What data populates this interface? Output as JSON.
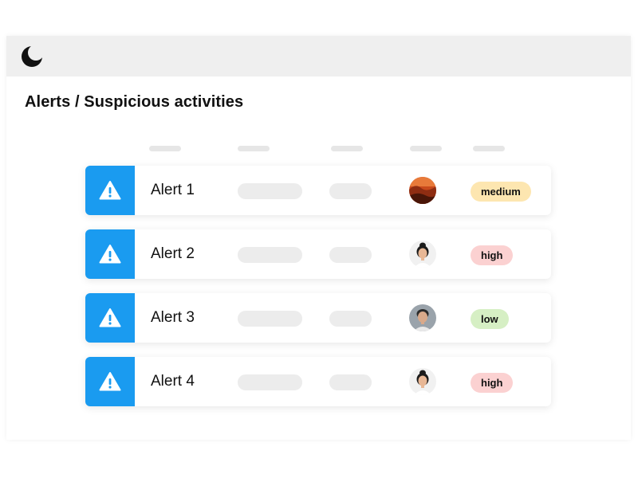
{
  "app": {
    "logo_icon": "moon-logo-icon"
  },
  "page": {
    "title": "Alerts / Suspicious activities"
  },
  "colors": {
    "accent": "#1a9bf0",
    "severity_medium": "#fde6b0",
    "severity_high": "#fbd1d1",
    "severity_low": "#d6efc4"
  },
  "alerts": [
    {
      "name": "Alert 1",
      "severity": "medium",
      "severity_color": "#fde6b0",
      "icon": "warning-icon",
      "avatar": "landscape-avatar"
    },
    {
      "name": "Alert 2",
      "severity": "high",
      "severity_color": "#fbd1d1",
      "icon": "warning-icon",
      "avatar": "woman-avatar"
    },
    {
      "name": "Alert 3",
      "severity": "low",
      "severity_color": "#d6efc4",
      "icon": "warning-icon",
      "avatar": "man-avatar"
    },
    {
      "name": "Alert 4",
      "severity": "high",
      "severity_color": "#fbd1d1",
      "icon": "warning-icon",
      "avatar": "woman-avatar"
    }
  ]
}
